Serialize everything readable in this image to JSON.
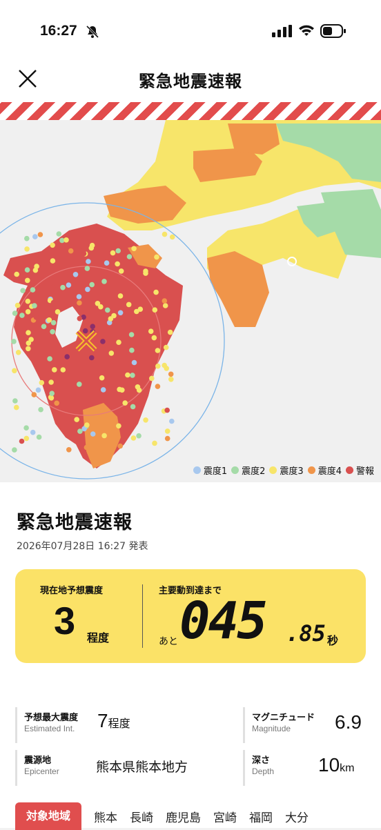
{
  "status_bar": {
    "time": "16:27"
  },
  "nav": {
    "title": "緊急地震速報"
  },
  "legend": [
    {
      "label": "震度1",
      "color": "#a8c8ee"
    },
    {
      "label": "震度2",
      "color": "#a5dba8"
    },
    {
      "label": "震度3",
      "color": "#f7e56a"
    },
    {
      "label": "震度4",
      "color": "#f0954a"
    },
    {
      "label": "警報",
      "color": "#d9504f"
    }
  ],
  "alert": {
    "title": "緊急地震速報",
    "issued": "2026年07月28日 16:27 発表",
    "local_label": "現在地予想震度",
    "local_value": "3",
    "local_unit": "程度",
    "arrival_label": "主要動到達まで",
    "arrival_prefix": "あと",
    "arrival_int": "045",
    "arrival_frac": ".85",
    "arrival_unit": "秒"
  },
  "details": {
    "max_int": {
      "jp": "予想最大震度",
      "en": "Estimated Int.",
      "value": "7",
      "unit": "程度"
    },
    "magnitude": {
      "jp": "マグニチュード",
      "en": "Magnitude",
      "value": "6.9"
    },
    "epicenter": {
      "jp": "震源地",
      "en": "Epicenter",
      "value": "熊本県熊本地方"
    },
    "depth": {
      "jp": "深さ",
      "en": "Depth",
      "value": "10",
      "unit": "km"
    }
  },
  "target": {
    "label": "対象地域",
    "regions": [
      "熊本",
      "長崎",
      "鹿児島",
      "宮崎",
      "福岡",
      "大分"
    ]
  }
}
